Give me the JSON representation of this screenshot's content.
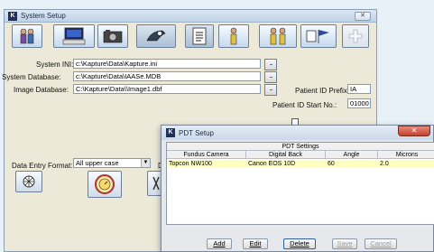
{
  "main_window": {
    "title": "System Setup",
    "app_icon_letter": "K",
    "close_label": "✕"
  },
  "toolbar": {
    "icons": [
      "users-icon",
      "computer-icon",
      "camera-icon",
      "eye-icon",
      "document-icon",
      "person-icon",
      "people-icon",
      "flag-icon",
      "plus-icon"
    ]
  },
  "paths": {
    "system_ini_label": "System INI:",
    "system_ini_value": "c:\\Kapture\\Data\\Kapture.ini",
    "system_db_label": "System Database:",
    "system_db_value": "c:\\Kapture\\Data\\IAASe.MDB",
    "image_db_label": "Image Database:",
    "image_db_value": "C:\\Kapture\\Data\\\\Image1.dbf",
    "browse_label": "..."
  },
  "patient": {
    "prefix_label": "Patient ID Prefix:",
    "prefix_value": "IA",
    "start_label": "Patient ID Start No.:",
    "start_value": "01000"
  },
  "entry_format": {
    "label": "Data Entry Format:",
    "value": "All upper case",
    "arrow": "▼",
    "cut_label": "D"
  },
  "pdt_dialog": {
    "title": "PDT Setup",
    "app_icon_letter": "K",
    "close_label": "✕",
    "group_header": "PDT Settings",
    "columns": [
      "Fundus Camera",
      "Digital Back",
      "Angle",
      "Microns"
    ],
    "rows": [
      [
        "Topcon NW100",
        "Canon EOS 10D",
        "60",
        "2.0"
      ]
    ],
    "buttons": {
      "add": "Add",
      "edit": "Edit",
      "delete": "Delete",
      "save": "Save",
      "cancel": "Cancel"
    }
  },
  "colors": {
    "selected_row": "#ffffc2",
    "close_button": "#c4402f"
  }
}
